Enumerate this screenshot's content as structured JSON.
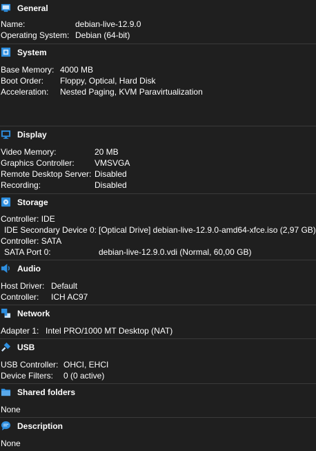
{
  "general": {
    "title": "General",
    "rows": [
      {
        "key": "Name:",
        "value": "debian-live-12.9.0"
      },
      {
        "key": "Operating System:",
        "value": "Debian (64-bit)"
      }
    ]
  },
  "system": {
    "title": "System",
    "rows": [
      {
        "key": "Base Memory:",
        "value": "4000 MB"
      },
      {
        "key": "Boot Order:",
        "value": "Floppy, Optical, Hard Disk"
      },
      {
        "key": "Acceleration:",
        "value": "Nested Paging, KVM Paravirtualization"
      }
    ]
  },
  "display": {
    "title": "Display",
    "rows": [
      {
        "key": "Video Memory:",
        "value": "20 MB"
      },
      {
        "key": "Graphics Controller:",
        "value": "VMSVGA"
      },
      {
        "key": "Remote Desktop Server:",
        "value": "Disabled"
      },
      {
        "key": "Recording:",
        "value": "Disabled"
      }
    ]
  },
  "storage": {
    "title": "Storage",
    "rows": [
      {
        "key": "Controller: IDE",
        "value": ""
      },
      {
        "key": " IDE Secondary Device 0:",
        "value": "[Optical Drive] debian-live-12.9.0-amd64-xfce.iso (2,97 GB)"
      },
      {
        "key": "Controller: SATA",
        "value": ""
      },
      {
        "key": " SATA Port 0:",
        "value": "debian-live-12.9.0.vdi (Normal, 60,00 GB)"
      }
    ]
  },
  "audio": {
    "title": "Audio",
    "rows": [
      {
        "key": "Host Driver:",
        "value": "Default"
      },
      {
        "key": "Controller:",
        "value": "ICH AC97"
      }
    ]
  },
  "network": {
    "title": "Network",
    "rows": [
      {
        "key": "Adapter 1:",
        "value": "Intel PRO/1000 MT Desktop (NAT)"
      }
    ]
  },
  "usb": {
    "title": "USB",
    "rows": [
      {
        "key": "USB Controller:",
        "value": "OHCI, EHCI"
      },
      {
        "key": "Device Filters:",
        "value": "0 (0 active)"
      }
    ]
  },
  "shared_folders": {
    "title": "Shared folders",
    "rows": [
      {
        "key": "None",
        "value": ""
      }
    ]
  },
  "description": {
    "title": "Description",
    "rows": [
      {
        "key": "None",
        "value": ""
      }
    ]
  },
  "colors": {
    "background": "#1f1f1f",
    "icon_blue": "#2e8fe0",
    "separator": "#3a3a3a"
  }
}
